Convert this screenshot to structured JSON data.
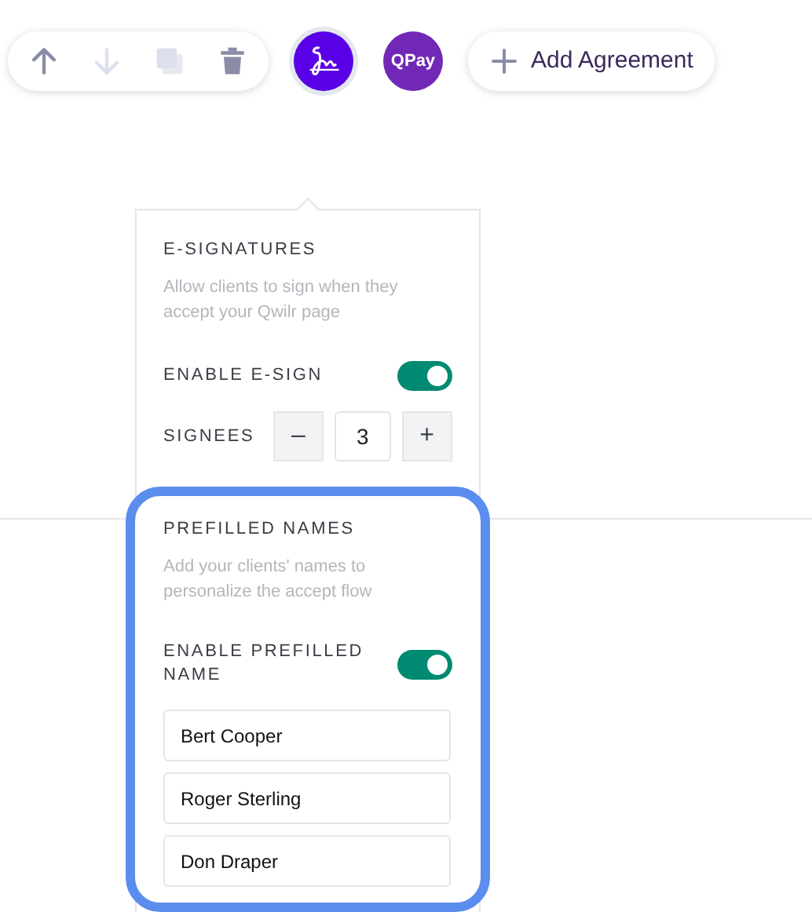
{
  "toolbar": {
    "tools": [
      {
        "kind": "up",
        "disabled": false
      },
      {
        "kind": "down",
        "disabled": true
      },
      {
        "kind": "copy",
        "disabled": true
      },
      {
        "kind": "delete",
        "disabled": false
      }
    ]
  },
  "blocks": [
    {
      "kind": "signature",
      "selected": true
    },
    {
      "kind": "text",
      "label": "QPay",
      "selected": false
    }
  ],
  "add_button": {
    "label": "Add Agreement"
  },
  "esign": {
    "title": "E-SIGNATURES",
    "description": "Allow clients to sign when they accept your Qwilr page",
    "enable_label": "ENABLE E-SIGN",
    "enabled": true,
    "signees_label": "SIGNEES",
    "decrement": "–",
    "signees": "3",
    "increment": "+"
  },
  "prefilled": {
    "title": "PREFILLED NAMES",
    "description": "Add your clients' names to personalize the accept flow",
    "enable_label": "ENABLE PREFILLED NAME",
    "enabled": true,
    "names": [
      "Bert Cooper",
      "Roger Sterling",
      "Don Draper"
    ]
  }
}
